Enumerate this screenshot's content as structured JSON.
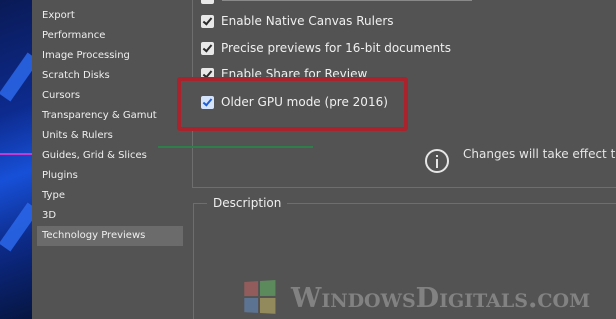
{
  "sidebar": {
    "items": [
      {
        "label": "Export"
      },
      {
        "label": "Performance"
      },
      {
        "label": "Image Processing"
      },
      {
        "label": "Scratch Disks"
      },
      {
        "label": "Cursors"
      },
      {
        "label": "Transparency & Gamut"
      },
      {
        "label": "Units & Rulers"
      },
      {
        "label": "Guides, Grid & Slices"
      },
      {
        "label": "Plugins"
      },
      {
        "label": "Type"
      },
      {
        "label": "3D"
      },
      {
        "label": "Technology Previews",
        "selected": true
      }
    ]
  },
  "options": [
    {
      "label": "Enable Native Canvas Rulers",
      "checked": true
    },
    {
      "label": "Precise previews for 16-bit documents",
      "checked": true
    },
    {
      "label": "Enable Share for Review",
      "checked": true
    },
    {
      "label": "Older GPU mode (pre 2016)",
      "checked": true
    }
  ],
  "notice": {
    "icon": "info-icon",
    "text": "Changes will take effect the"
  },
  "description": {
    "label": "Description"
  },
  "watermark": {
    "text": "WindowsDigitals.com"
  },
  "colors": {
    "highlight": "#a8232b",
    "panel_bg": "#535353",
    "selected_bg": "#6b6b6b"
  }
}
